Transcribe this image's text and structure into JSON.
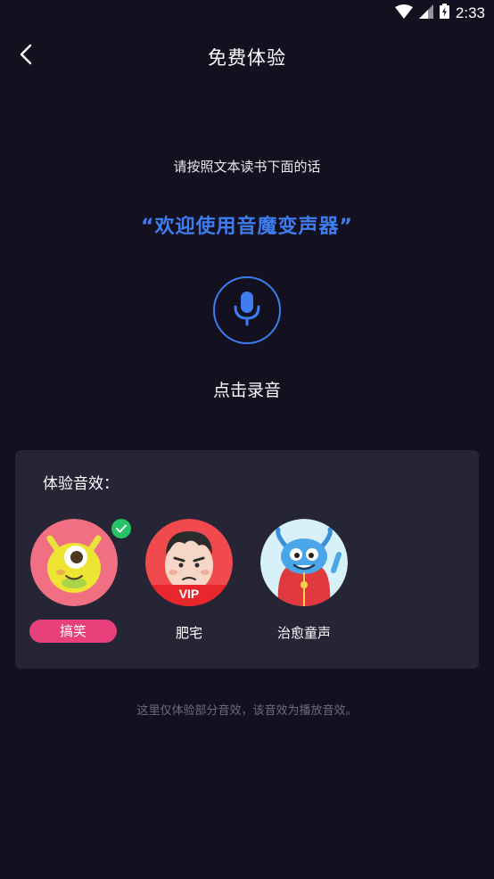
{
  "status_bar": {
    "time": "2:33"
  },
  "header": {
    "title": "免费体验"
  },
  "instruction": "请按照文本读书下面的话",
  "quote": "“欢迎使用音魔变声器”",
  "record": {
    "label": "点击录音"
  },
  "effects": {
    "title": "体验音效：",
    "items": [
      {
        "label": "搞笑",
        "selected": true
      },
      {
        "label": "肥宅",
        "badge": "VIP"
      },
      {
        "label": "治愈童声"
      }
    ]
  },
  "footnote": "这里仅体验部分音效，该音效为播放音效。",
  "colors": {
    "background": "#13111f",
    "card": "#262536",
    "accent_blue": "#3e7cf0",
    "selected_pink": "#e8407a",
    "check_green": "#26c266"
  }
}
